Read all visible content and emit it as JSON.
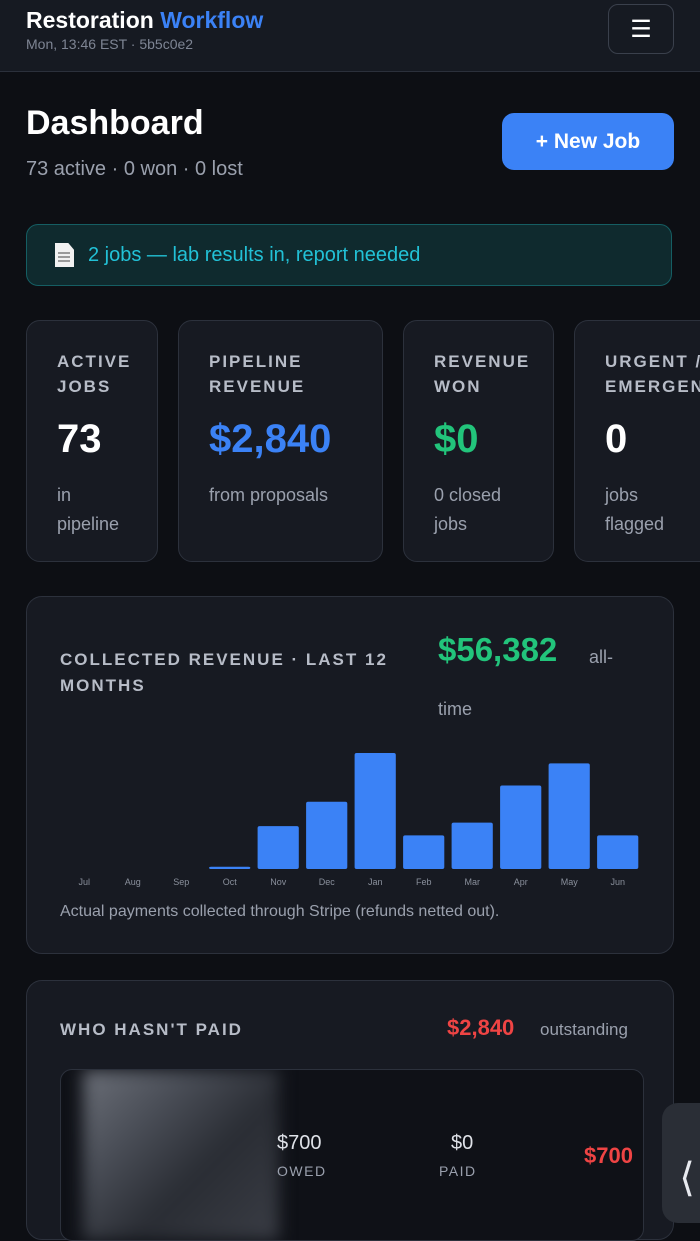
{
  "header": {
    "brand_main": "Restoration",
    "brand_accent": "Workflow",
    "subline": "Mon, 13:46 EST · 5b5c0e2",
    "menu_icon": "hamburger-icon"
  },
  "dashboard": {
    "title": "Dashboard",
    "summary": "73 active · 0 won · 0 lost",
    "new_job_label": "+ New Job"
  },
  "alert": {
    "icon": "document-icon",
    "text": "2 jobs — lab results in, report needed"
  },
  "stats": [
    {
      "label": "ACTIVE\nJOBS",
      "value": "73",
      "note": "in\npipeline",
      "color": "#ffffff"
    },
    {
      "label": "PIPELINE\nREVENUE",
      "value": "$2,840",
      "note": "from proposals",
      "color": "#3b82f6"
    },
    {
      "label": "REVENUE\nWON",
      "value": "$0",
      "note": "0 closed\njobs",
      "color": "#22c47b"
    },
    {
      "label": "URGENT /\nEMERGENCY",
      "value": "0",
      "note": "jobs flagged",
      "color": "#ffffff"
    }
  ],
  "revenue": {
    "title": "COLLECTED REVENUE · LAST 12 MONTHS",
    "total": "$56,382",
    "total_suffix_1": "all-",
    "total_suffix_2": "time",
    "caption": "Actual payments collected through Stripe (refunds netted out)."
  },
  "chart_data": {
    "type": "bar",
    "categories": [
      "Jul",
      "Aug",
      "Sep",
      "Oct",
      "Nov",
      "Dec",
      "Jan",
      "Feb",
      "Mar",
      "Apr",
      "May",
      "Jun"
    ],
    "values": [
      0,
      0,
      0,
      2,
      37,
      58,
      100,
      29,
      40,
      72,
      91,
      29
    ],
    "bar_color": "#3b82f6"
  },
  "unpaid": {
    "title": "WHO HASN'T PAID",
    "total": "$2,840",
    "total_suffix": "outstanding",
    "row": {
      "owed_value": "$700",
      "owed_label": "OWED",
      "paid_value": "$0",
      "paid_label": "PAID",
      "balance": "$700"
    }
  },
  "side_tab": {
    "glyph": "⟨",
    "icon": "chevron-left-icon"
  }
}
